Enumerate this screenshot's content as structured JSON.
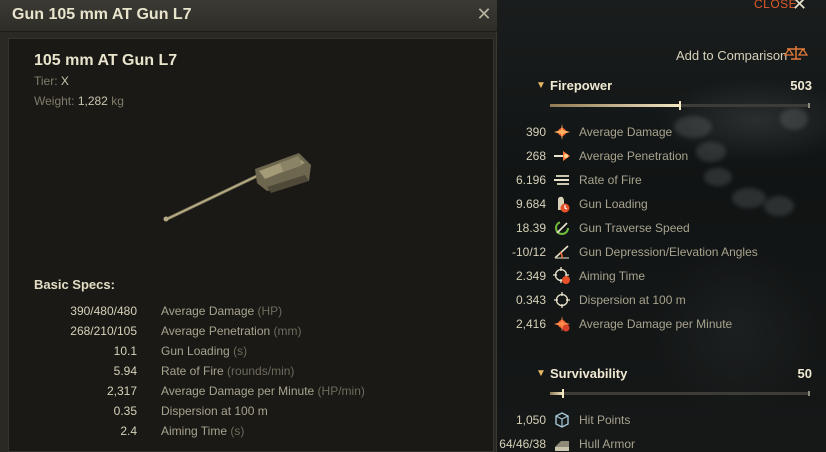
{
  "window": {
    "title": "Gun 105 mm AT Gun L7"
  },
  "module": {
    "name": "105 mm AT Gun L7",
    "tier_label": "Tier:",
    "tier_value": "X",
    "weight_label": "Weight:",
    "weight_value": "1,282",
    "weight_unit": "kg"
  },
  "basic_specs": {
    "title": "Basic Specs:",
    "rows": [
      {
        "value": "390/480/480",
        "label": "Average Damage",
        "unit": "(HP)"
      },
      {
        "value": "268/210/105",
        "label": "Average Penetration",
        "unit": "(mm)"
      },
      {
        "value": "10.1",
        "label": "Gun Loading",
        "unit": "(s)"
      },
      {
        "value": "5.94",
        "label": "Rate of Fire",
        "unit": "(rounds/min)"
      },
      {
        "value": "2,317",
        "label": "Average Damage per Minute",
        "unit": "(HP/min)"
      },
      {
        "value": "0.35",
        "label": "Dispersion at 100 m",
        "unit": ""
      },
      {
        "value": "2.4",
        "label": "Aiming Time",
        "unit": "(s)"
      }
    ]
  },
  "right_panel": {
    "close_label": "CLOSE",
    "compare_label": "Add to Comparison",
    "firepower": {
      "title": "Firepower",
      "value": "503",
      "bar_fraction": 0.5,
      "stats": [
        {
          "value": "390",
          "label": "Average Damage",
          "icon": "damage-icon"
        },
        {
          "value": "268",
          "label": "Average Penetration",
          "icon": "penetration-icon"
        },
        {
          "value": "6.196",
          "label": "Rate of Fire",
          "icon": "rate-of-fire-icon"
        },
        {
          "value": "9.684",
          "label": "Gun Loading",
          "icon": "shell-loading-icon"
        },
        {
          "value": "18.39",
          "label": "Gun Traverse Speed",
          "icon": "traverse-icon"
        },
        {
          "value": "-10/12",
          "label": "Gun Depression/Elevation Angles",
          "icon": "angles-icon"
        },
        {
          "value": "2.349",
          "label": "Aiming Time",
          "icon": "aiming-time-icon"
        },
        {
          "value": "0.343",
          "label": "Dispersion at 100 m",
          "icon": "crosshair-icon"
        },
        {
          "value": "2,416",
          "label": "Average Damage per Minute",
          "icon": "damage-per-minute-icon"
        }
      ]
    },
    "survivability": {
      "title": "Survivability",
      "value": "50",
      "bar_fraction": 0.05,
      "stats": [
        {
          "value": "1,050",
          "label": "Hit Points",
          "icon": "hit-points-icon"
        },
        {
          "value": "64/46/38",
          "label": "Hull Armor",
          "icon": "hull-armor-icon"
        }
      ]
    }
  }
}
